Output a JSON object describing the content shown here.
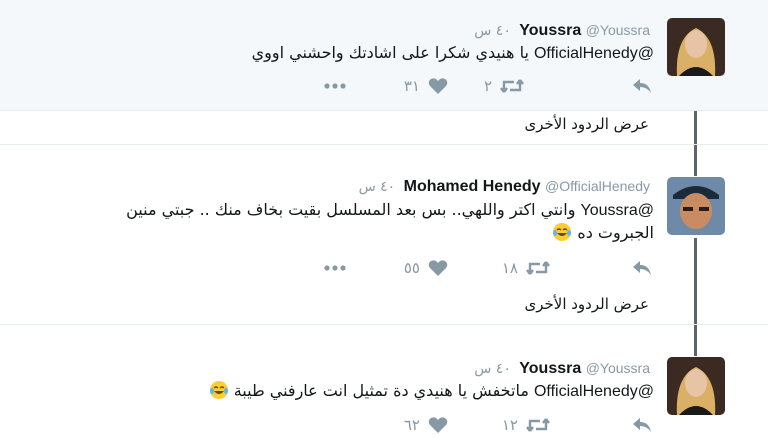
{
  "tweets": [
    {
      "name": "Youssra",
      "handle": "@Youssra",
      "time": "٤٠ س",
      "mention": "@OfficialHenedy",
      "body": "يا هنيدي شكرا على اشادتك واحشني اووي",
      "body_line2": "",
      "replies": "",
      "retweets": "٢",
      "likes": "٣١",
      "avatar": "avatar-youssra"
    },
    {
      "name": "Mohamed Henedy",
      "handle": "@OfficialHenedy",
      "time": "٤٠ س",
      "mention": "@Youssra",
      "body": "وانتي اكتر واللهي.. بس بعد المسلسل بقيت بخاف منك .. جبتي منين",
      "body_line2": "الجبروت ده",
      "replies": "",
      "retweets": "١٨",
      "likes": "٥٥",
      "avatar": "avatar-henedy"
    },
    {
      "name": "Youssra",
      "handle": "@Youssra",
      "time": "٤٠ س",
      "mention": "@OfficialHenedy",
      "body": "ماتخفش يا هنيدي دة تمثيل انت عارفني طيبة",
      "body_line2": "",
      "replies": "",
      "retweets": "١٢",
      "likes": "٦٢",
      "avatar": "avatar-youssra"
    }
  ],
  "more_replies_label": "عرض الردود الأخرى",
  "icons": [
    "reply-icon",
    "retweet-icon",
    "like-icon",
    "more-icon",
    "tears-of-joy-emoji"
  ],
  "colors": {
    "action_gray": "#8899a6",
    "highlight_bg": "#f5f8fa",
    "thread_line": "#5f6368"
  }
}
